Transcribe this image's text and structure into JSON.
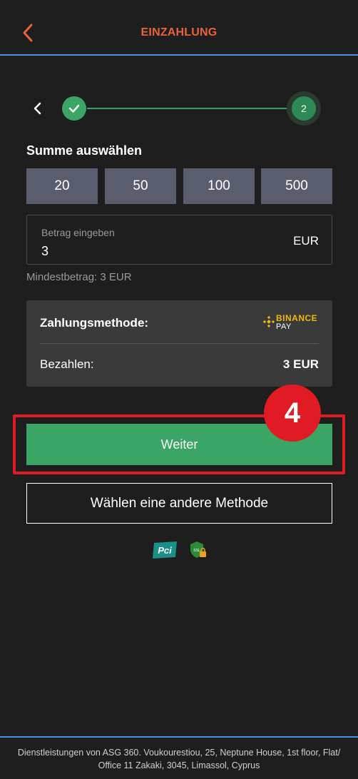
{
  "header": {
    "title": "EINZAHLUNG",
    "back_icon": "chevron-left-icon",
    "accent_color": "#e8633a"
  },
  "stepper": {
    "back_icon": "chevron-left-icon",
    "step1_icon": "checkmark-icon",
    "step2_label": "2",
    "completed_color": "#3aa565"
  },
  "amount_section": {
    "title": "Summe auswählen",
    "presets": [
      "20",
      "50",
      "100",
      "500"
    ]
  },
  "amount_input": {
    "label": "Betrag eingeben",
    "value": "3",
    "currency": "EUR"
  },
  "min_hint": "Mindestbetrag: 3 EUR",
  "summary": {
    "method_label": "Zahlungsmethode:",
    "method_logo_line1": "BINANCE",
    "method_logo_line2": "PAY",
    "pay_label": "Bezahlen:",
    "pay_value": "3 EUR"
  },
  "annotation": {
    "badge_number": "4",
    "highlight_color": "#e01b24"
  },
  "actions": {
    "continue_label": "Weiter",
    "other_method_label": "Wählen eine andere Methode"
  },
  "security_badges": {
    "pci_label": "PCI",
    "ssl_label": "SSL"
  },
  "footer": {
    "text": "Dienstleistungen von ASG 360. Voukourestiou, 25, Neptune House, 1st floor, Flat/ Office 11 Zakaki, 3045, Limassol, Cyprus"
  }
}
